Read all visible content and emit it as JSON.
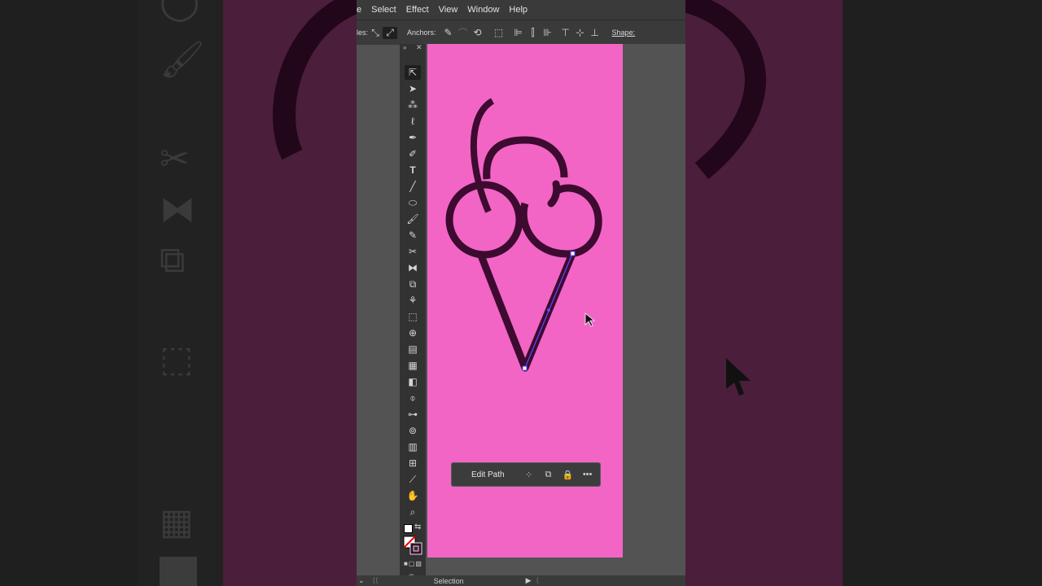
{
  "menubar": {
    "items": [
      "e",
      "Select",
      "Effect",
      "View",
      "Window",
      "Help"
    ]
  },
  "control_bar": {
    "handles_label": "les:",
    "anchors_label": "Anchors:",
    "shape_label": "Shape:"
  },
  "toolbar": {
    "tools": [
      "selection-tool",
      "direct-selection-tool",
      "magic-wand-tool",
      "lasso-tool",
      "pen-tool",
      "curvature-tool",
      "type-tool",
      "line-tool",
      "ellipse-tool",
      "paintbrush-tool",
      "shaper-tool",
      "scissors-tool",
      "reflect-tool",
      "scale-tool",
      "puppet-warp-tool",
      "free-transform-tool",
      "shape-builder-tool",
      "perspective-grid-tool",
      "mesh-tool",
      "gradient-tool",
      "eyedropper-tool",
      "blend-tool",
      "symbol-sprayer-tool",
      "column-graph-tool",
      "artboard-tool",
      "slice-tool",
      "hand-tool",
      "zoom-tool"
    ]
  },
  "context_bar": {
    "edit_path_label": "Edit Path"
  },
  "status_bar": {
    "mode": "Selection"
  },
  "colors": {
    "artboard": "#f265c5",
    "stroke": "#3d0a30",
    "selection": "#5c4aff",
    "app_bg": "#535353",
    "panel": "#323232"
  }
}
